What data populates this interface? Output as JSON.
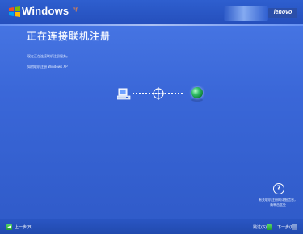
{
  "header": {
    "windows_label": "Windows",
    "xp_label": "xp",
    "brand_label": "lenovo"
  },
  "main": {
    "title": "正在连接联机注册",
    "info_lines": [
      "现在正在连接联机注册服务。",
      "如何联机注册 Windows XP"
    ],
    "help_icon_glyph": "?",
    "help_text": "有关联机注册的详细信息，请单击此处"
  },
  "footer": {
    "back_label": "上一步(B)",
    "skip_label": "跳过(S)",
    "next_label": "下一步(N)"
  },
  "icons": {
    "windows_flag": "windows-flag-icon",
    "computer": "computer-icon",
    "globe": "globe-icon",
    "target": "target-icon",
    "help": "help-icon",
    "back": "back-arrow-icon",
    "next": "next-arrow-icon"
  },
  "colors": {
    "background": "#3a67d8",
    "header": "#254fbc",
    "accent_green": "#36c06a",
    "xp_orange": "#ff8a3a"
  }
}
